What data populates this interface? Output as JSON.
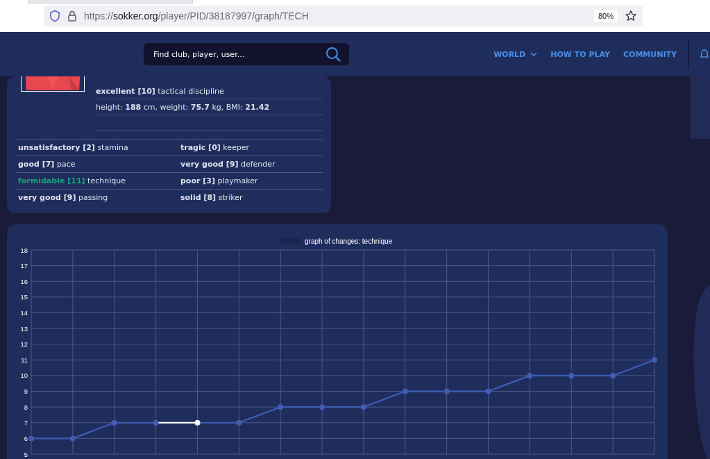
{
  "browser": {
    "tab_fragment": true,
    "url": {
      "scheme": "https://",
      "host": "sokker.org",
      "path": "/player/PID/38187997/graph/TECH"
    },
    "zoom": "80%"
  },
  "header": {
    "search": {
      "placeholder": "Find club, player, user..."
    },
    "nav": [
      {
        "label": "WORLD",
        "dropdown": true
      },
      {
        "label": "HOW TO PLAY",
        "dropdown": false
      },
      {
        "label": "COMMUNITY",
        "dropdown": false
      }
    ]
  },
  "player": {
    "details": [
      {
        "kind": "skill",
        "level": "excellent [10]",
        "name": "tactical discipline",
        "color": "#dde2f0"
      },
      {
        "kind": "text",
        "text": "height: **188** cm, weight: **75.7** kg, BMI: **21.42**"
      },
      {
        "kind": "blank"
      }
    ],
    "skills": [
      {
        "level": "unsatisfactory [2]",
        "name": "stamina",
        "color": "#dde2f0"
      },
      {
        "level": "tragic [0]",
        "name": "keeper",
        "color": "#dde2f0"
      },
      {
        "level": "good [7]",
        "name": "pace",
        "color": "#dde2f0"
      },
      {
        "level": "very good [9]",
        "name": "defender",
        "color": "#dde2f0"
      },
      {
        "level": "formidable [11]",
        "name": "technique",
        "color": "#1ea27a"
      },
      {
        "level": "poor [3]",
        "name": "playmaker",
        "color": "#dde2f0"
      },
      {
        "level": "very good [9]",
        "name": "passing",
        "color": "#dde2f0"
      },
      {
        "level": "solid [8]",
        "name": "striker",
        "color": "#dde2f0"
      }
    ]
  },
  "graph": {
    "points": [
      {
        "hovered": false
      },
      {
        "hovered": false
      },
      {
        "hovered": false
      },
      {
        "hovered": false
      },
      {
        "hovered": true
      },
      {
        "hovered": false
      },
      {
        "hovered": false
      },
      {
        "hovered": false
      },
      {
        "hovered": false
      },
      {
        "hovered": false
      },
      {
        "hovered": false
      },
      {
        "hovered": false
      },
      {
        "hovered": false
      },
      {
        "hovered": false
      },
      {
        "hovered": false
      },
      {
        "hovered": false
      }
    ],
    "chart_data": {
      "type": "line",
      "grid": true,
      "ylim": [
        5,
        18
      ],
      "yticks": [
        5,
        6,
        7,
        8,
        9,
        10,
        11,
        12,
        13,
        14,
        15,
        16,
        17,
        18
      ],
      "series": [
        {
          "name": "graph of changes: technique",
          "color": "#3f5db3",
          "marker": "circle",
          "values": [
            6,
            6,
            7,
            7,
            7,
            7,
            8,
            8,
            8,
            9,
            9,
            9,
            10,
            10,
            10,
            11
          ]
        }
      ]
    }
  }
}
